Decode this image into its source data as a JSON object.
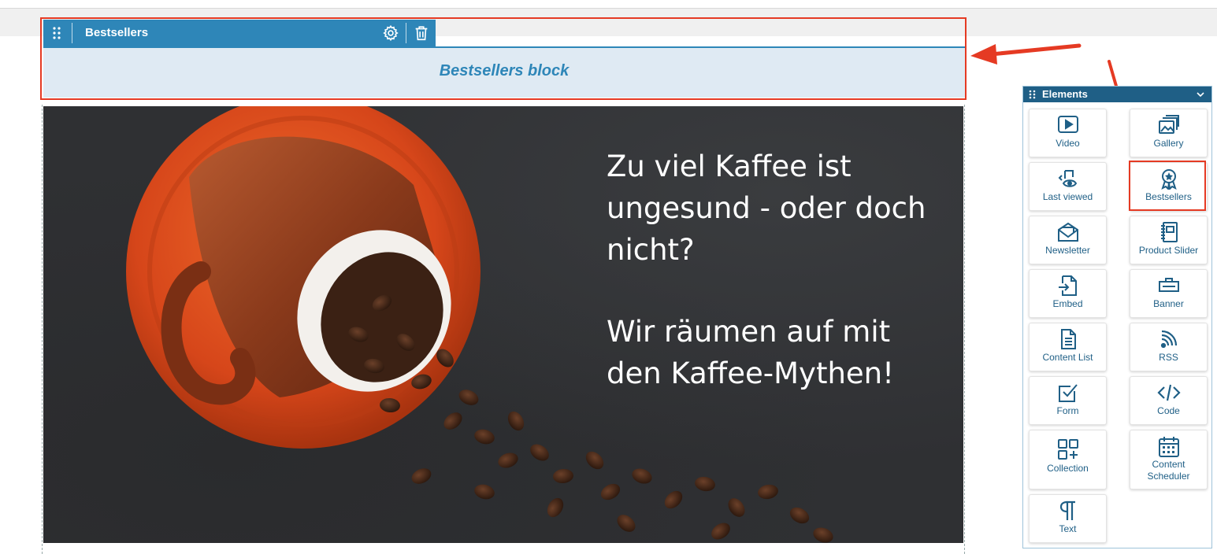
{
  "block": {
    "title": "Bestsellers",
    "label": "Bestsellers block"
  },
  "hero": {
    "line1": "Zu viel Kaffee ist ungesund - oder doch nicht?",
    "line2": "Wir räumen auf mit den Kaffee-Mythen!"
  },
  "panel": {
    "title": "Elements",
    "items": [
      {
        "label": "Video",
        "icon": "video-icon"
      },
      {
        "label": "Gallery",
        "icon": "gallery-icon"
      },
      {
        "label": "Last viewed",
        "icon": "last-viewed-icon"
      },
      {
        "label": "Bestsellers",
        "icon": "award-icon"
      },
      {
        "label": "Newsletter",
        "icon": "envelope-icon"
      },
      {
        "label": "Product Slider",
        "icon": "notebook-icon"
      },
      {
        "label": "Embed",
        "icon": "embed-file-icon"
      },
      {
        "label": "Banner",
        "icon": "banner-icon"
      },
      {
        "label": "Content List",
        "icon": "content-list-icon"
      },
      {
        "label": "RSS",
        "icon": "rss-icon"
      },
      {
        "label": "Form",
        "icon": "form-check-icon"
      },
      {
        "label": "Code",
        "icon": "code-icon"
      },
      {
        "label": "Collection",
        "icon": "collection-icon"
      },
      {
        "label": "Content Scheduler",
        "icon": "calendar-icon"
      },
      {
        "label": "Text",
        "icon": "paragraph-icon"
      }
    ]
  },
  "colors": {
    "toolbar": "#2e86b8",
    "block_bg": "#dfeaf3",
    "panel_header": "#1f5f86",
    "highlight": "#e53a23"
  }
}
